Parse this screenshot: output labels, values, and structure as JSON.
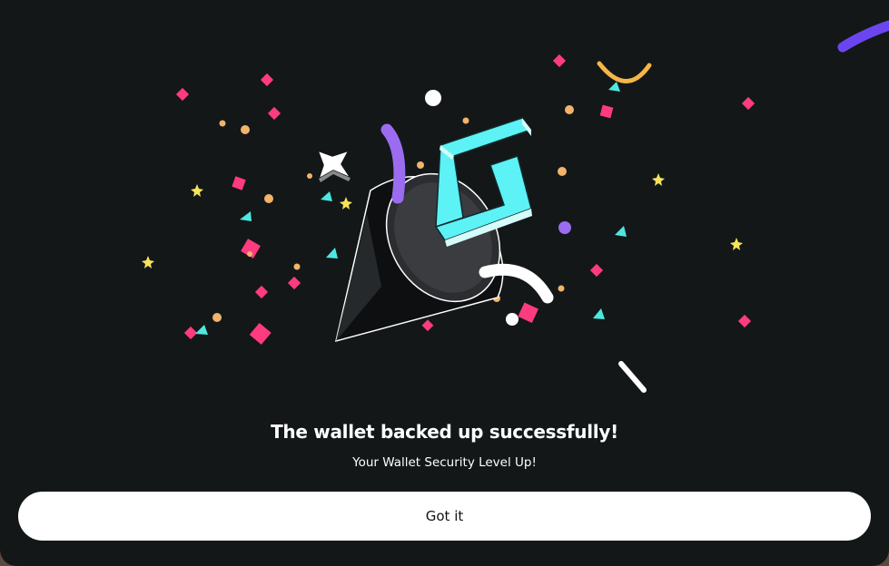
{
  "dialog": {
    "title": "The wallet backed up successfully!",
    "subtitle": "Your Wallet Security Level Up!",
    "button_label": "Got it"
  },
  "colors": {
    "background": "#131718",
    "button_background": "#ffffff",
    "button_text": "#111111",
    "confetti_pink": "#ff3b7f",
    "confetti_cyan": "#4de8e0",
    "confetti_yellow": "#f7e35c",
    "confetti_orange": "#f2b36b",
    "confetti_purple": "#9b6cf0",
    "logo_cyan": "#5df2f5"
  },
  "illustration": {
    "icon": "party-popper-icon"
  }
}
